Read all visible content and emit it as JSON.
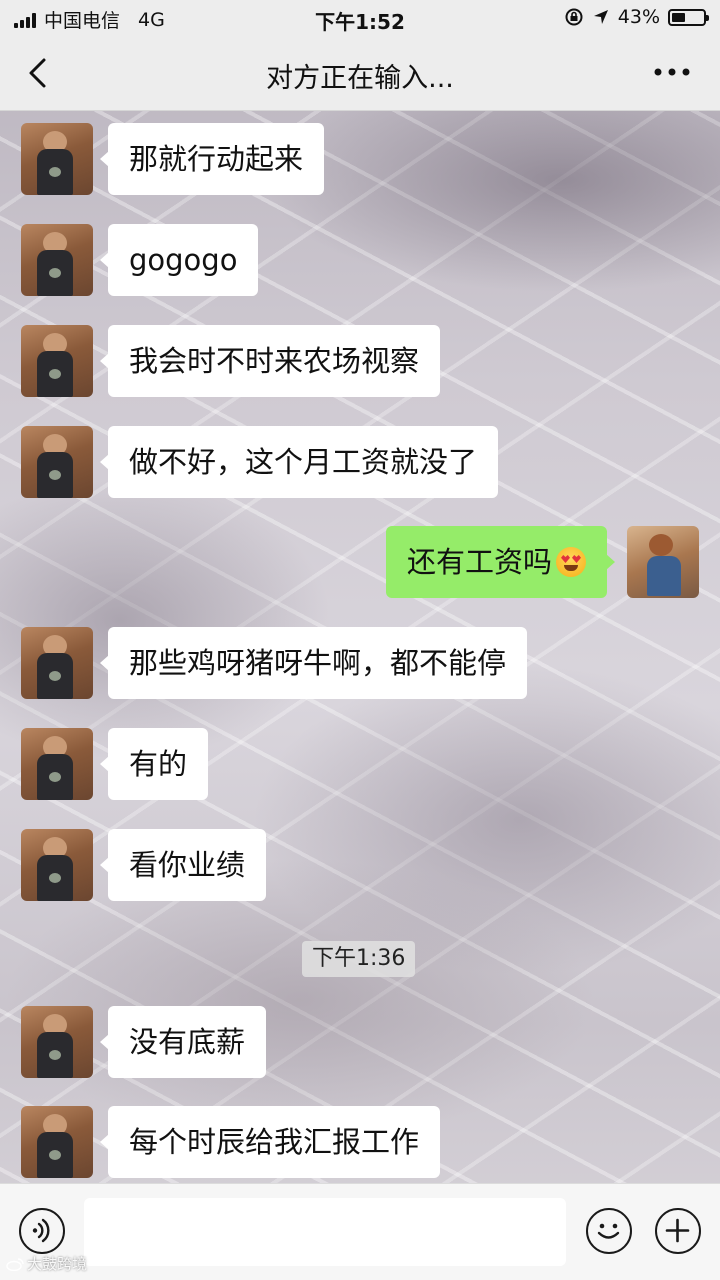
{
  "status_bar": {
    "carrier": "中国电信",
    "network": "4G",
    "time": "下午1:52",
    "battery_percent": "43%",
    "battery_level": 0.43
  },
  "nav": {
    "title": "对方正在输入..."
  },
  "messages": [
    {
      "sender": "other",
      "text": "那就行动起来"
    },
    {
      "sender": "other",
      "text": "gogogo"
    },
    {
      "sender": "other",
      "text": "我会时不时来农场视察"
    },
    {
      "sender": "other",
      "text": "做不好，这个月工资就没了"
    },
    {
      "sender": "me",
      "text": "还有工资吗",
      "emoji": "heart-eyes-emoji"
    },
    {
      "sender": "other",
      "text": "那些鸡呀猪呀牛啊，都不能停"
    },
    {
      "sender": "other",
      "text": "有的"
    },
    {
      "sender": "other",
      "text": "看你业绩"
    },
    {
      "sender": "other",
      "text": "没有底薪"
    },
    {
      "sender": "other",
      "text": "每个时辰给我汇报工作"
    }
  ],
  "time_divider": "下午1:36",
  "input": {
    "value": "",
    "placeholder": ""
  },
  "watermark": "大鼓跨境",
  "colors": {
    "my_bubble": "#95ec69",
    "their_bubble": "#ffffff",
    "bar_background": "#ededed"
  }
}
